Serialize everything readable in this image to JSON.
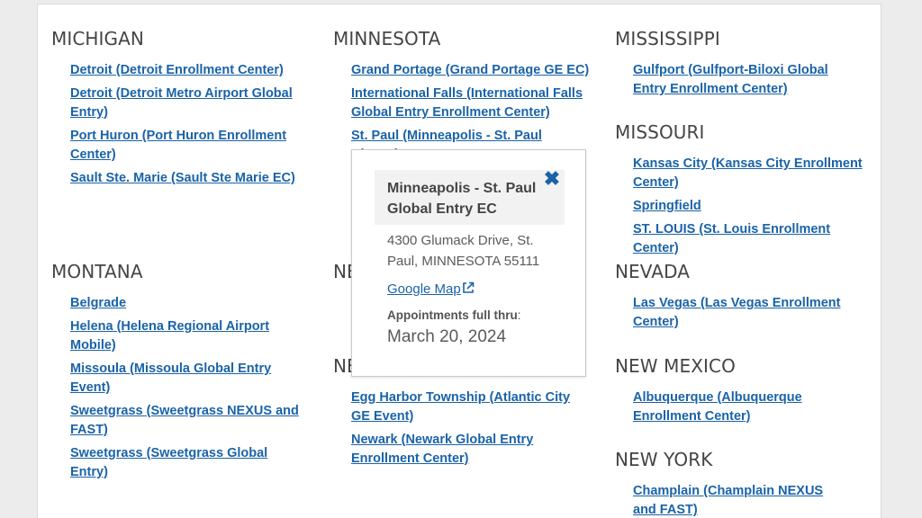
{
  "states": {
    "michigan": {
      "title": "MICHIGAN",
      "items": [
        "Detroit (Detroit Enrollment Center)",
        "Detroit (Detroit Metro Airport Global Entry)",
        "Port Huron (Port Huron Enrollment Center)",
        "Sault Ste. Marie (Sault Ste Marie EC)"
      ]
    },
    "minnesota": {
      "title": "MINNESOTA",
      "items": [
        "Grand Portage (Grand Portage GE EC)",
        "International Falls (International Falls Global Entry Enrollment Center)",
        "St. Paul (Minneapolis - St. Paul Airport)"
      ]
    },
    "mississippi": {
      "title": "MISSISSIPPI",
      "items": [
        "Gulfport (Gulfport-Biloxi Global Entry Enrollment Center)"
      ]
    },
    "missouri": {
      "title": "MISSOURI",
      "items": [
        "Kansas City (Kansas City Enrollment Center)",
        "Springfield",
        "ST. LOUIS (St. Louis Enrollment Center)"
      ]
    },
    "montana": {
      "title": "MONTANA",
      "items": [
        "Belgrade",
        "Helena (Helena Regional Airport Mobile)",
        "Missoula (Missoula Global Entry Event)",
        "Sweetgrass (Sweetgrass NEXUS and FAST)",
        "Sweetgrass (Sweetgrass Global Entry)"
      ]
    },
    "ne_partial_1": {
      "title": "NE"
    },
    "ne_partial_2": {
      "title": "NE"
    },
    "new_jersey_items": [
      "Egg Harbor Township (Atlantic City GE Event)",
      "Newark (Newark Global Entry Enrollment Center)"
    ],
    "nevada": {
      "title": "NEVADA",
      "items": [
        "Las Vegas (Las Vegas Enrollment Center)"
      ]
    },
    "new_mexico": {
      "title": "NEW MEXICO",
      "items": [
        "Albuquerque (Albuquerque Enrollment Center)"
      ]
    },
    "new_york": {
      "title": "NEW YORK",
      "items": [
        "Champlain (Champlain NEXUS and FAST)"
      ]
    }
  },
  "popup": {
    "title": "Minneapolis - St. Paul Global Entry EC",
    "close_icon": "close-x-icon",
    "address": "4300 Glumack Drive, St. Paul, MINNESOTA 55111",
    "map_link": "Google Map",
    "map_icon": "external-link-icon",
    "appointments_label": "Appointments full thru",
    "appointments_colon": ":",
    "appointments_date": "March 20, 2024"
  },
  "colors": {
    "link": "#1a63a8",
    "heading": "#454545",
    "background": "#ececec"
  }
}
